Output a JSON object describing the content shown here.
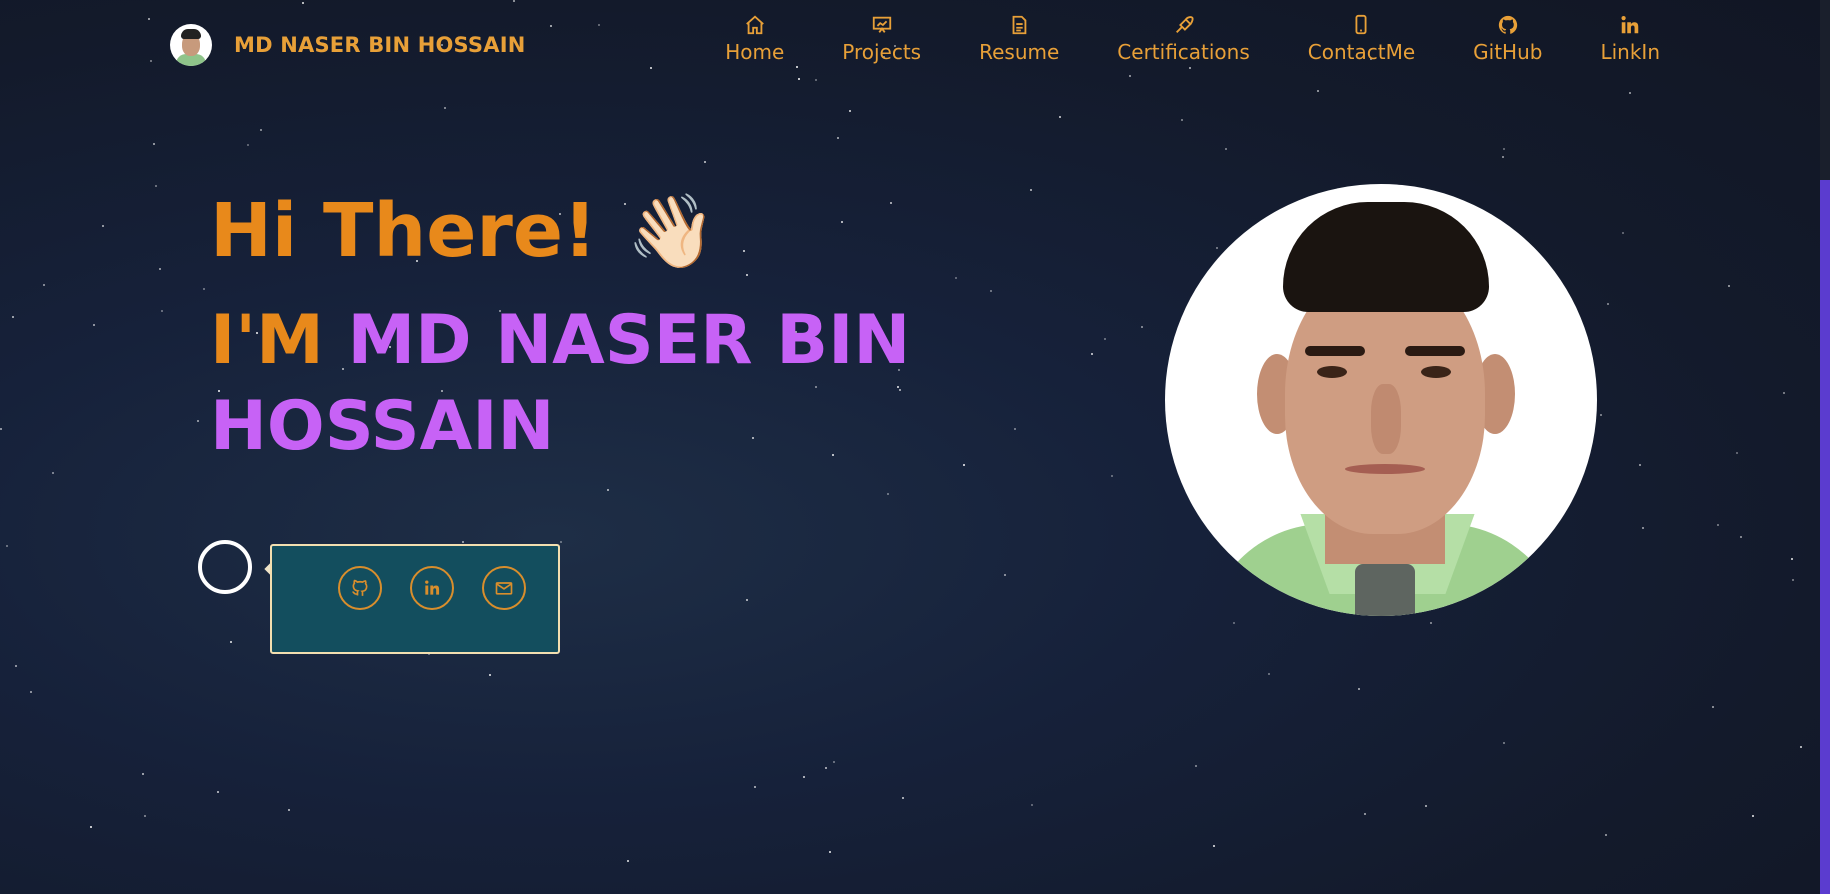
{
  "brand": {
    "name": "MD NASER BIN HOSSAIN"
  },
  "nav": {
    "items": [
      {
        "label": "Home",
        "icon": "home-icon"
      },
      {
        "label": "Projects",
        "icon": "presentation-icon"
      },
      {
        "label": "Resume",
        "icon": "document-icon"
      },
      {
        "label": "Certifications",
        "icon": "pen-nib-icon"
      },
      {
        "label": "ContactMe",
        "icon": "phone-icon"
      },
      {
        "label": "GitHub",
        "icon": "github-icon"
      },
      {
        "label": "LinkIn",
        "icon": "linkedin-icon"
      }
    ]
  },
  "hero": {
    "greeting": "Hi There!",
    "wave_emoji": "👋🏻",
    "im_prefix": "I'M",
    "name_line1": "MD NASER BIN",
    "name_line2": "HOSSAIN"
  },
  "social": {
    "icons": [
      "github-icon",
      "linkedin-icon",
      "mail-icon"
    ]
  },
  "colors": {
    "accent_orange": "#e8891b",
    "name_purple": "#c762f6",
    "social_box_bg": "#134e5e",
    "scroll_thumb": "#5b3ccf"
  }
}
